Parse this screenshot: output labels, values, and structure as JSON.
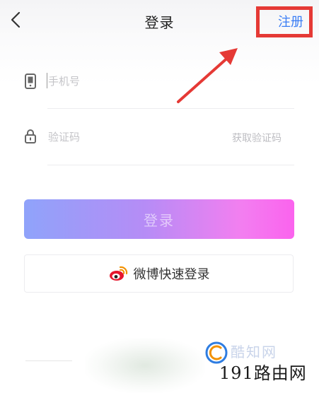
{
  "header": {
    "title": "登录",
    "register_label": "注册",
    "back_icon": "chevron-left-icon"
  },
  "form": {
    "phone": {
      "icon": "phone-icon",
      "placeholder": "手机号",
      "value": ""
    },
    "code": {
      "icon": "lock-icon",
      "placeholder": "验证码",
      "value": "",
      "get_code_label": "获取验证码"
    },
    "login_label": "登录",
    "weibo": {
      "icon": "weibo-icon",
      "label": "微博快速登录"
    }
  },
  "annotation": {
    "highlight_color": "#e53935",
    "arrow_color": "#e53935"
  },
  "watermark": {
    "text_top": "酷知网",
    "text_bottom": "191路由网"
  },
  "colors": {
    "accent": "#3a7df5",
    "login_gradient": [
      "#8fa3fa",
      "#b68cf6",
      "#f27ff0",
      "#fb63ee"
    ]
  }
}
